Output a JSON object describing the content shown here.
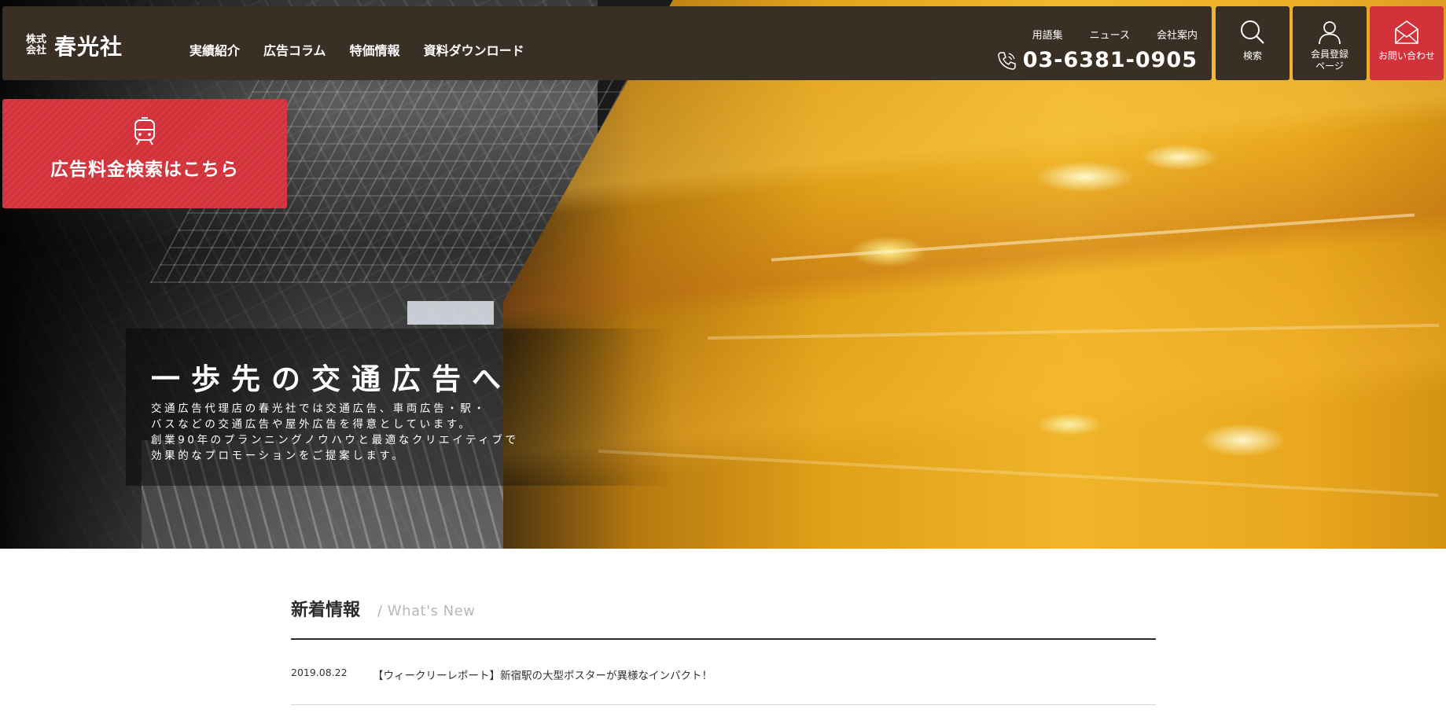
{
  "header": {
    "logo": {
      "small": "株式\n会社",
      "main": "春光社"
    },
    "nav": [
      {
        "label": "実績紹介"
      },
      {
        "label": "広告コラム"
      },
      {
        "label": "特価情報"
      },
      {
        "label": "資料ダウンロード"
      }
    ],
    "utility": [
      {
        "label": "用語集"
      },
      {
        "label": "ニュース"
      },
      {
        "label": "会社案内"
      }
    ],
    "phone": "03-6381-0905",
    "buttons": {
      "search": {
        "label": "検索",
        "icon": "search-icon"
      },
      "member": {
        "label_line1": "会員登録",
        "label_line2": "ページ",
        "icon": "user-icon"
      },
      "contact": {
        "label": "お問い合わせ",
        "icon": "mail-icon"
      }
    }
  },
  "cta": {
    "label": "広告料金検索はこちら",
    "icon": "train-icon"
  },
  "hero": {
    "title": "一歩先の交通広告へ",
    "body": [
      "交通広告代理店の春光社では交通広告、車両広告・駅・",
      "バスなどの交通広告や屋外広告を得意としています。",
      "創業90年のプランニングノウハウと最適なクリエイティブで",
      "効果的なプロモーションをご提案します。"
    ]
  },
  "news": {
    "title": "新着情報",
    "subtitle": "/ What's New",
    "items": [
      {
        "date": "2019.08.22",
        "text": "【ウィークリーレポート】新宿駅の大型ポスターが異様なインパクト！"
      }
    ]
  },
  "colors": {
    "header_bg": "#3a2f25",
    "accent_red": "#d2323a",
    "text_dark": "#2b2b2b"
  }
}
